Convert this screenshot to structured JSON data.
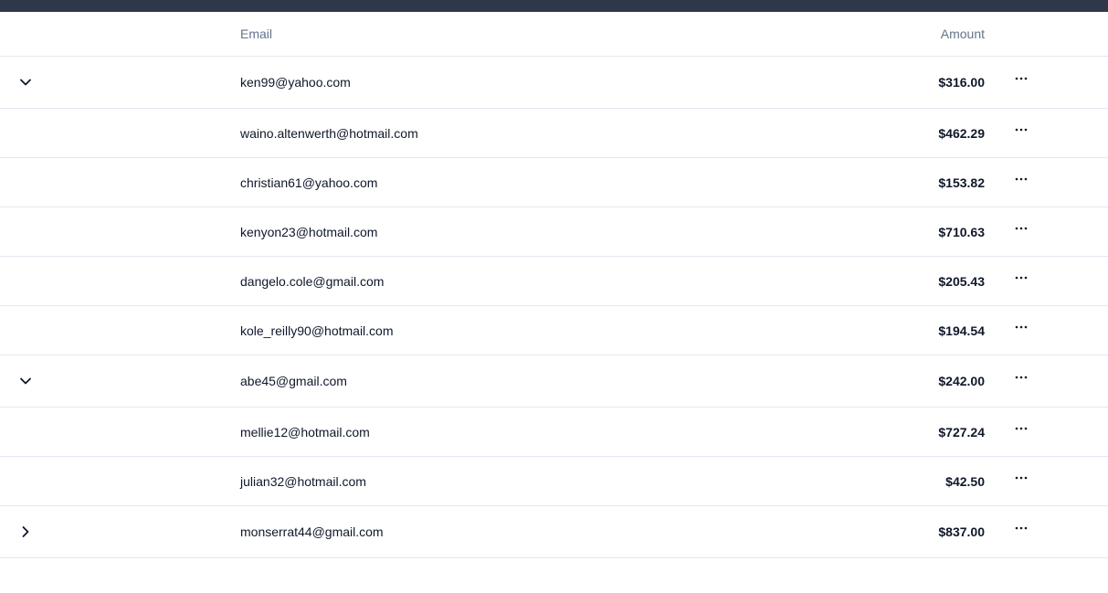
{
  "table": {
    "headers": {
      "email": "Email",
      "amount": "Amount"
    },
    "rows": [
      {
        "kind": "parent",
        "expanded": true,
        "email": "ken99@yahoo.com",
        "amount": "$316.00"
      },
      {
        "kind": "child",
        "email": "waino.altenwerth@hotmail.com",
        "amount": "$462.29"
      },
      {
        "kind": "child",
        "email": "christian61@yahoo.com",
        "amount": "$153.82"
      },
      {
        "kind": "child",
        "email": "kenyon23@hotmail.com",
        "amount": "$710.63"
      },
      {
        "kind": "child",
        "email": "dangelo.cole@gmail.com",
        "amount": "$205.43"
      },
      {
        "kind": "child",
        "email": "kole_reilly90@hotmail.com",
        "amount": "$194.54"
      },
      {
        "kind": "parent",
        "expanded": true,
        "email": "abe45@gmail.com",
        "amount": "$242.00"
      },
      {
        "kind": "child",
        "email": "mellie12@hotmail.com",
        "amount": "$727.24"
      },
      {
        "kind": "child",
        "email": "julian32@hotmail.com",
        "amount": "$42.50"
      },
      {
        "kind": "parent",
        "expanded": false,
        "email": "monserrat44@gmail.com",
        "amount": "$837.00"
      }
    ]
  },
  "icons": {
    "expanded": "chevron-down-icon",
    "collapsed": "chevron-right-icon",
    "actions": "more-horizontal-icon"
  },
  "colors": {
    "topbar": "#2f3848",
    "border": "#e2e8f0",
    "header_text": "#64748b",
    "text": "#0f172a"
  }
}
